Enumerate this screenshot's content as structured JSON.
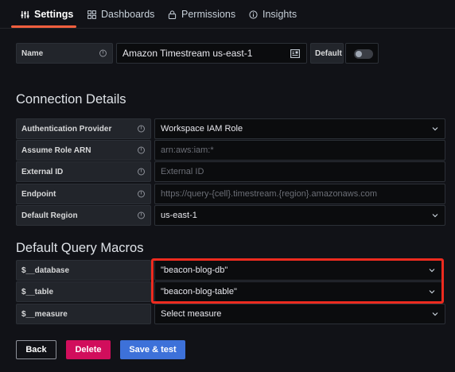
{
  "tabs": [
    {
      "label": "Settings",
      "icon": "sliders-icon",
      "active": true
    },
    {
      "label": "Dashboards",
      "icon": "grid-icon",
      "active": false
    },
    {
      "label": "Permissions",
      "icon": "lock-icon",
      "active": false
    },
    {
      "label": "Insights",
      "icon": "info-circle-icon",
      "active": false
    }
  ],
  "name_row": {
    "label": "Name",
    "value": "Amazon Timestream us-east-1",
    "default_label": "Default",
    "default_on": false
  },
  "connection": {
    "title": "Connection Details",
    "fields": [
      {
        "label": "Authentication Provider",
        "value": "Workspace IAM Role",
        "placeholder": "",
        "type": "select"
      },
      {
        "label": "Assume Role ARN",
        "value": "",
        "placeholder": "arn:aws:iam:*",
        "type": "input"
      },
      {
        "label": "External ID",
        "value": "",
        "placeholder": "External ID",
        "type": "input"
      },
      {
        "label": "Endpoint",
        "value": "",
        "placeholder": "https://query-{cell}.timestream.{region}.amazonaws.com",
        "type": "input"
      },
      {
        "label": "Default Region",
        "value": "us-east-1",
        "placeholder": "",
        "type": "select"
      }
    ]
  },
  "macros": {
    "title": "Default Query Macros",
    "fields": [
      {
        "label": "$__database",
        "value": "\"beacon-blog-db\""
      },
      {
        "label": "$__table",
        "value": "\"beacon-blog-table\""
      },
      {
        "label": "$__measure",
        "value": "Select measure"
      }
    ]
  },
  "buttons": {
    "back": "Back",
    "delete": "Delete",
    "save": "Save & test"
  },
  "colors": {
    "accent": "#f55f3e",
    "delete": "#d10e5c",
    "save": "#3d71d9",
    "highlight": "#ed2b1f"
  }
}
